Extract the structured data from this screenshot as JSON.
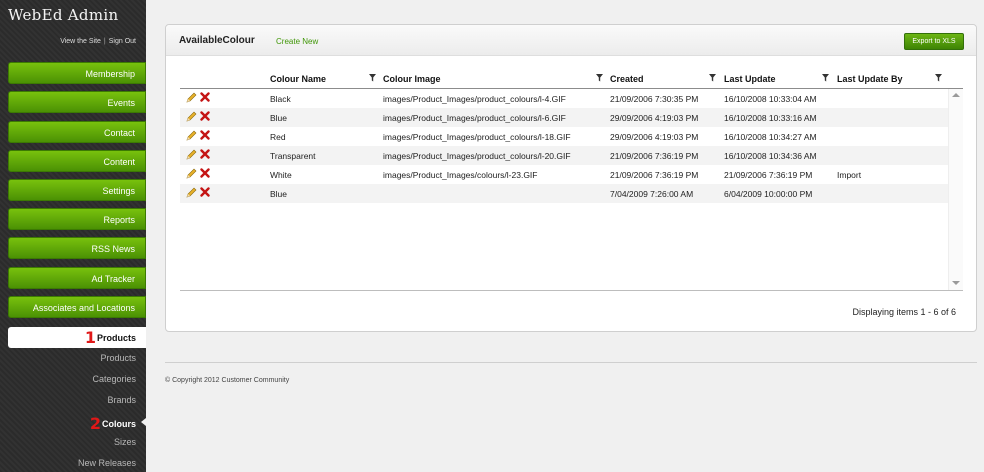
{
  "sidebar": {
    "brand": "WebEd Admin",
    "view_site": "View the Site",
    "sign_out": "Sign Out",
    "separator": "|",
    "nav": [
      "Membership",
      "Events",
      "Contact",
      "Content",
      "Settings",
      "Reports",
      "RSS News",
      "Ad Tracker",
      "Associates and Locations"
    ],
    "active_badge": "1",
    "active_label": "Products",
    "sub_items": [
      "Products",
      "Categories",
      "Brands"
    ],
    "colours_badge": "2",
    "colours_label": "Colours",
    "sub_items_after": [
      "Sizes",
      "New Releases"
    ],
    "accent_color": "#5aa509"
  },
  "panel": {
    "title": "AvailableColour",
    "create_new": "Create New",
    "export": "Export to XLS"
  },
  "grid": {
    "columns": [
      "Colour Name",
      "Colour Image",
      "Created",
      "Last Update",
      "Last Update By"
    ],
    "rows": [
      {
        "name": "Black",
        "image": "images/Product_Images/product_colours/l-4.GIF",
        "created": "21/09/2006 7:30:35 PM",
        "updated": "16/10/2008 10:33:04 AM",
        "by": ""
      },
      {
        "name": "Blue",
        "image": "images/Product_Images/product_colours/l-6.GIF",
        "created": "29/09/2006 4:19:03 PM",
        "updated": "16/10/2008 10:33:16 AM",
        "by": ""
      },
      {
        "name": "Red",
        "image": "images/Product_Images/product_colours/l-18.GIF",
        "created": "29/09/2006 4:19:03 PM",
        "updated": "16/10/2008 10:34:27 AM",
        "by": ""
      },
      {
        "name": "Transparent",
        "image": "images/Product_Images/product_colours/l-20.GIF",
        "created": "21/09/2006 7:36:19 PM",
        "updated": "16/10/2008 10:34:36 AM",
        "by": ""
      },
      {
        "name": "White",
        "image": "images/Product_Images/colours/l-23.GIF",
        "created": "21/09/2006 7:36:19 PM",
        "updated": "21/09/2006 7:36:19 PM",
        "by": "Import"
      },
      {
        "name": "Blue",
        "image": "",
        "created": "7/04/2009 7:26:00 AM",
        "updated": "6/04/2009 10:00:00 PM",
        "by": ""
      }
    ],
    "paging": "Displaying items 1 - 6 of 6"
  },
  "footer": {
    "copyright": "© Copyright 2012 Customer Community"
  }
}
